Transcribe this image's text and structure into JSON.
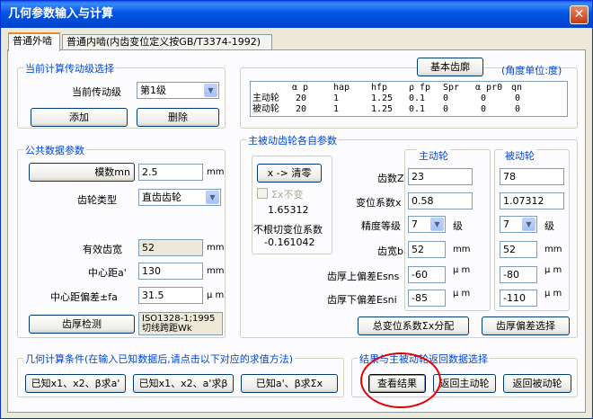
{
  "window": {
    "title": "几何参数输入与计算",
    "close": "✕"
  },
  "tabs": [
    "普通外啮",
    "普通内啮(内齿变位定义按GB/T3374-1992)"
  ],
  "stage": {
    "title": "当前计算传动级选择",
    "current_label": "当前传动级",
    "current_value": "第1级",
    "add": "添加",
    "delete": "删除"
  },
  "profile": {
    "basic_button": "基本齿廓",
    "unit_note": "(角度单位:度)",
    "headers": [
      "α p",
      "hap",
      "hfp",
      "ρ fp",
      "Spr",
      "α pr0",
      "qn"
    ],
    "rows": [
      {
        "label": "主动轮",
        "values": [
          "20",
          "1",
          "1.25",
          "0.1",
          "0",
          "0",
          "0"
        ]
      },
      {
        "label": "被动轮",
        "values": [
          "20",
          "1",
          "1.25",
          "0.1",
          "0",
          "0",
          "0"
        ]
      }
    ]
  },
  "common": {
    "title": "公共数据参数",
    "module_button": "模数mn",
    "module_value": "2.5",
    "module_unit": "mm",
    "gear_type_label": "齿轮类型",
    "gear_type_value": "直齿齿轮",
    "face_width_label": "有效齿宽",
    "face_width_value": "52",
    "face_width_unit": "mm",
    "center_label": "中心距a'",
    "center_value": "130",
    "center_unit": "mm",
    "center_dev_label": "中心距偏差±fa",
    "center_dev_value": "31.5",
    "center_dev_unit": "μ m",
    "thickness_button": "齿厚检测",
    "thickness_note_1": "ISO1328-1;1995",
    "thickness_note_2": "切线跨距Wk"
  },
  "gears": {
    "title": "主被动齿轮各自参数",
    "clear_button": "x -> 清零",
    "sum_fixed_label": "Σx不变",
    "sum_value": "1.65312",
    "nonundercut_label": "不根切变位系数",
    "nonundercut_value": "-0.161042",
    "driver_title": "主动轮",
    "driven_title": "被动轮",
    "teeth_label": "齿数Z",
    "shift_label": "变位系数x",
    "grade_label": "精度等级",
    "grade_unit": "级",
    "width_label": "齿宽b",
    "width_unit": "mm",
    "upper_dev_label": "齿厚上偏差Esns",
    "lower_dev_label": "齿厚下偏差Esni",
    "dev_unit": "μ m",
    "driver": {
      "teeth": "23",
      "shift": "0.58",
      "grade": "7",
      "width": "52",
      "upper": "-60",
      "lower": "-85"
    },
    "driven": {
      "teeth": "78",
      "shift": "1.07312",
      "grade": "7",
      "width": "52",
      "upper": "-80",
      "lower": "-110"
    },
    "total_shift_button": "总变位系数Σx分配",
    "tolerance_button": "齿厚偏差选择"
  },
  "calc": {
    "title": "几何计算条件(在输入已知数据后,请点击以下对应的求值方法)",
    "btn1": "已知x1、x2、β求a'",
    "btn2": "已知x1、x2、a'求β",
    "btn3": "已知a'、β求Σx"
  },
  "results": {
    "title": "结果与主被动轮返回数据选择",
    "view": "查看结果",
    "return_driver": "返回主动轮",
    "return_driven": "返回被动轮"
  }
}
